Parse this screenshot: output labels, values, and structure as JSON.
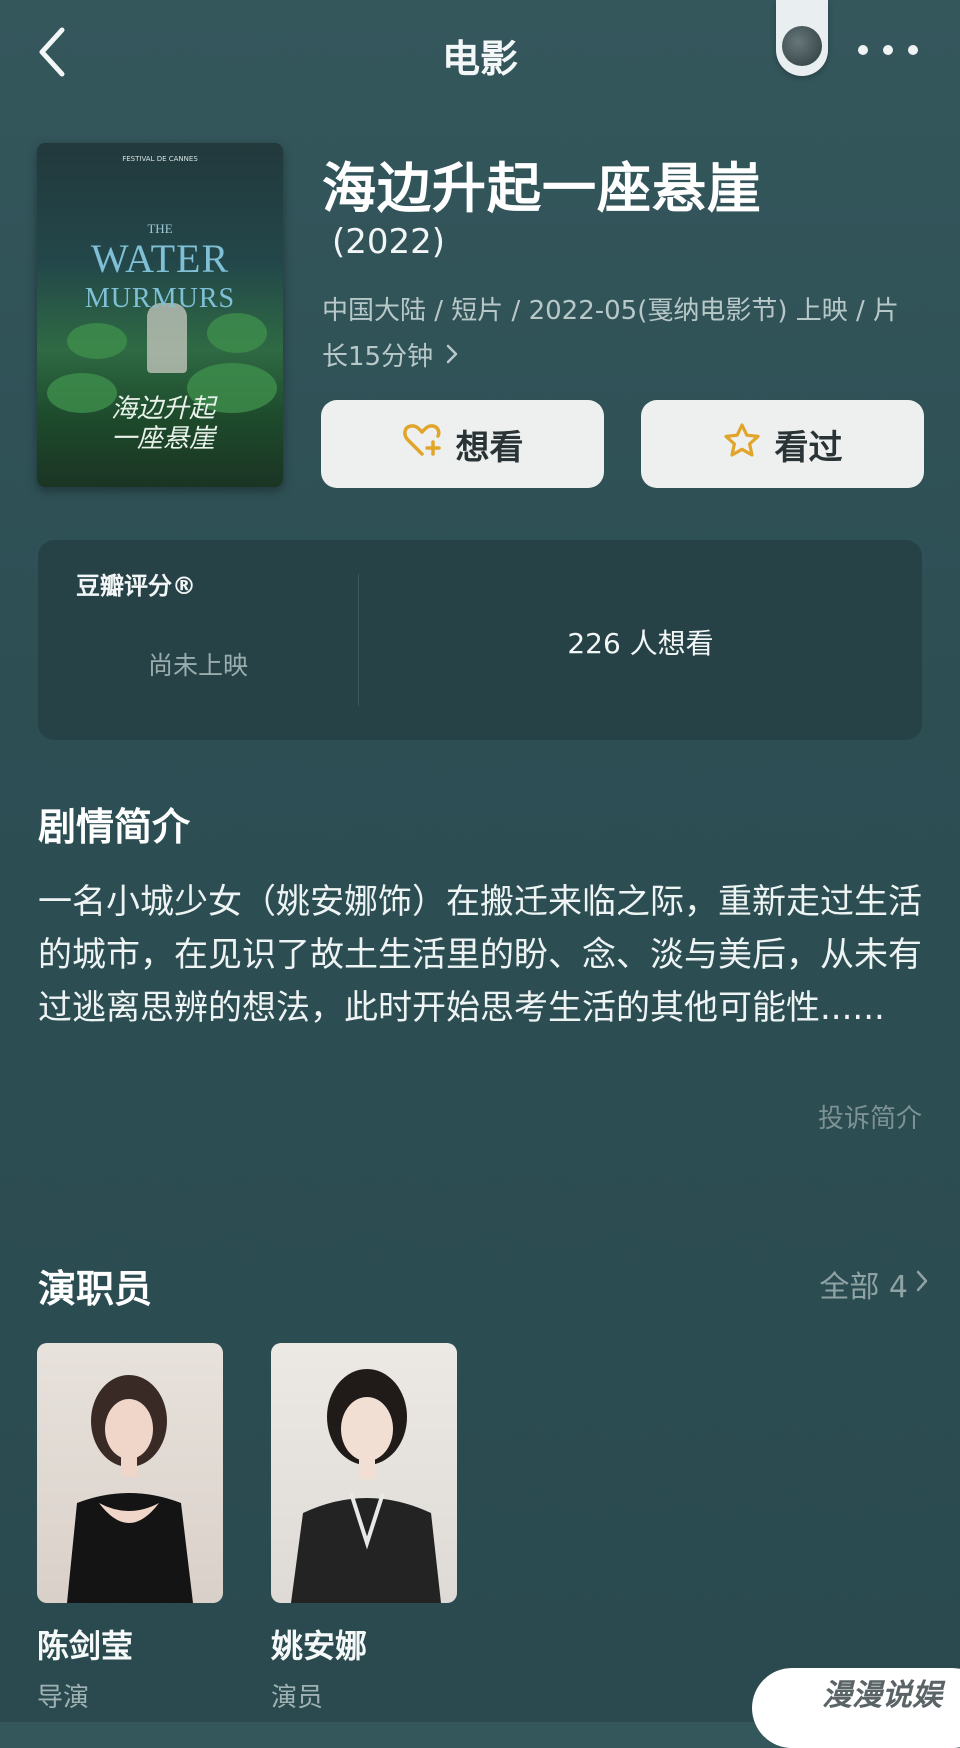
{
  "nav": {
    "title": "电影"
  },
  "poster": {
    "festival_text": "FESTIVAL DE CANNES",
    "title_line1": "THE",
    "title_line2": "WATER",
    "title_line3": "MURMURS",
    "title_cn_line1": "海边升起",
    "title_cn_line2": "一座悬崖"
  },
  "movie": {
    "title": "海边升起一座悬崖",
    "year": "(2022)",
    "meta": "中国大陆 / 短片 / 2022-05(戛纳电影节) 上映 / 片长15分钟"
  },
  "actions": {
    "want_label": "想看",
    "seen_label": "看过",
    "accent_color": "#e0a52a"
  },
  "rating": {
    "label": "豆瓣评分®",
    "status": "尚未上映",
    "want_count": "226 人想看"
  },
  "synopsis": {
    "heading": "剧情简介",
    "text": "一名小城少女（姚安娜饰）在搬迁来临之际，重新走过生活的城市，在见识了故土生活里的盼、念、淡与美后，从未有过逃离思辨的想法，此时开始思考生活的其他可能性......",
    "report_label": "投诉简介"
  },
  "cast": {
    "heading": "演职员",
    "all_label": "全部 4",
    "members": [
      {
        "name": "陈剑莹",
        "role": "导演"
      },
      {
        "name": "姚安娜",
        "role": "演员"
      }
    ]
  },
  "watermark": {
    "text": "漫漫说娱"
  }
}
